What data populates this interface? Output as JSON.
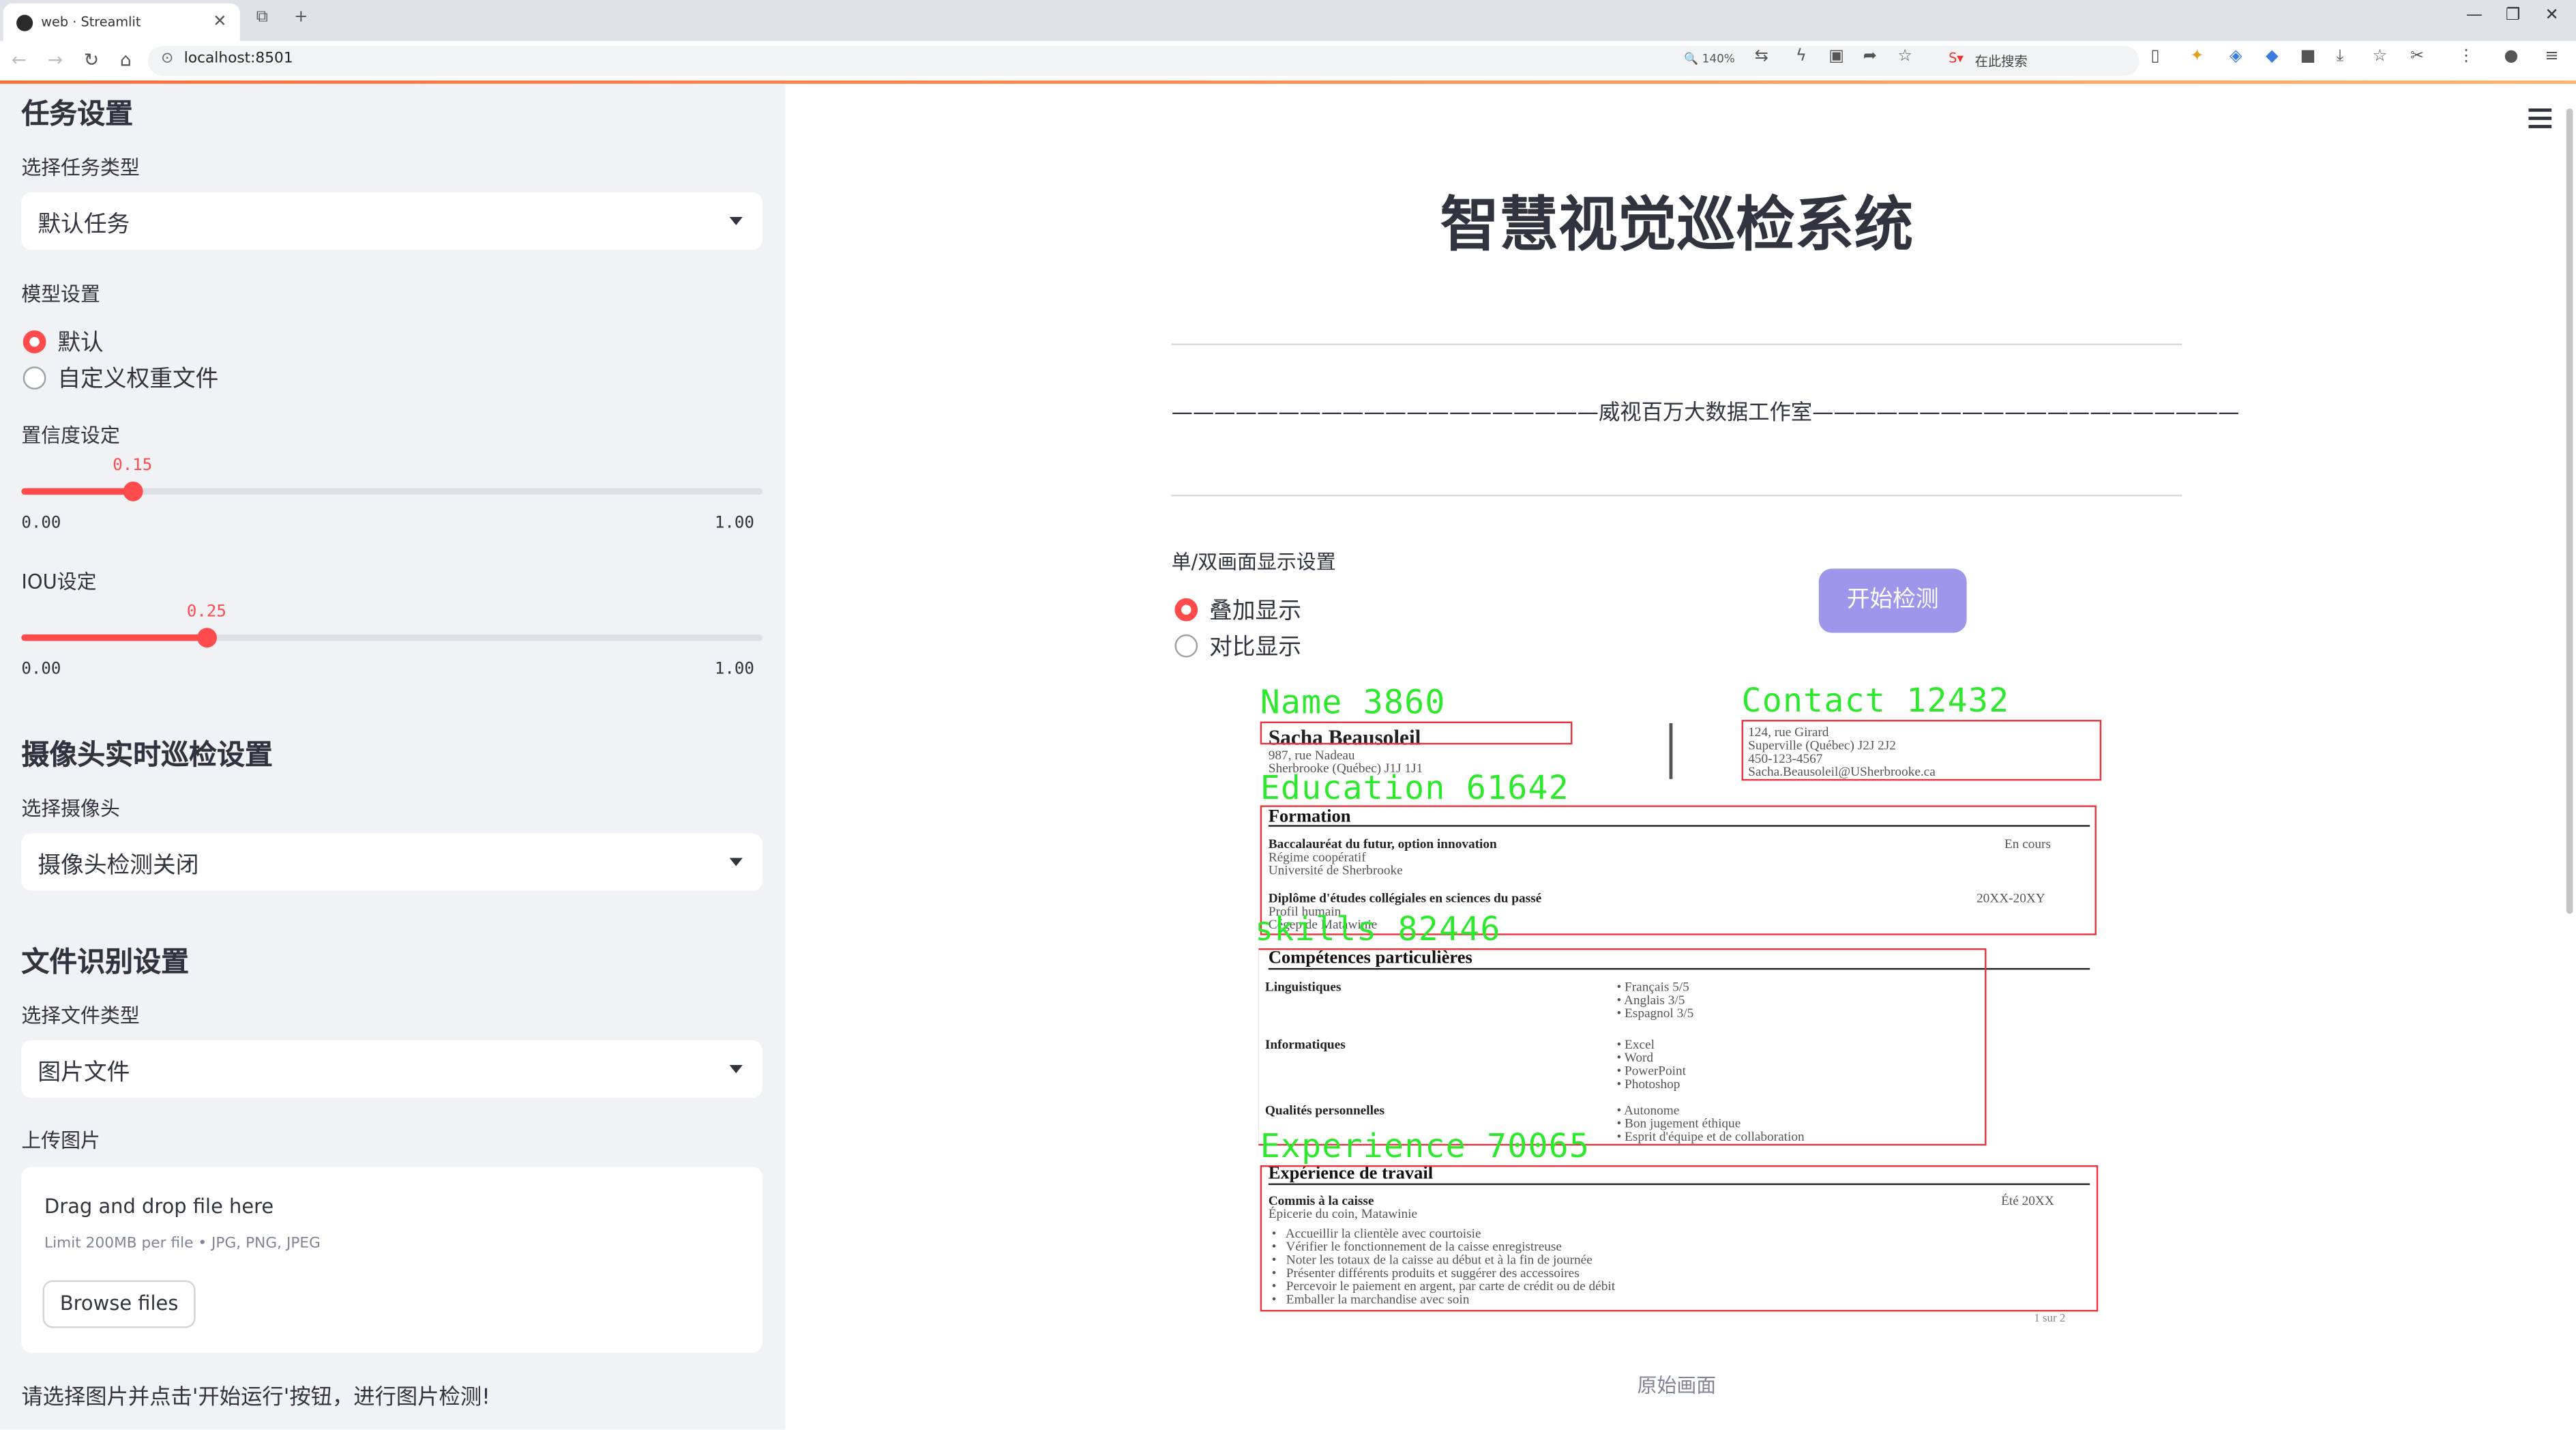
{
  "browser": {
    "tab_title": "web · Streamlit",
    "url": "localhost:8501",
    "zoom": "140%",
    "search_placeholder": "在此搜索"
  },
  "sidebar": {
    "task_section": "任务设置",
    "task_type_label": "选择任务类型",
    "task_type_value": "默认任务",
    "model_label": "模型设置",
    "model_options": [
      "默认",
      "自定义权重文件"
    ],
    "model_selected": 0,
    "conf_label": "置信度设定",
    "conf": {
      "value": 0.15,
      "value_text": "0.15",
      "min_text": "0.00",
      "max_text": "1.00"
    },
    "iou_label": "IOU设定",
    "iou": {
      "value": 0.25,
      "value_text": "0.25",
      "min_text": "0.00",
      "max_text": "1.00"
    },
    "camera_section": "摄像头实时巡检设置",
    "camera_label": "选择摄像头",
    "camera_value": "摄像头检测关闭",
    "file_section": "文件识别设置",
    "file_type_label": "选择文件类型",
    "file_type_value": "图片文件",
    "upload_label": "上传图片",
    "upload": {
      "drag_text": "Drag and drop file here",
      "limit_text": "Limit 200MB per file • JPG, PNG, JPEG",
      "browse_label": "Browse files"
    },
    "hint": "请选择图片并点击'开始运行'按钮，进行图片检测!"
  },
  "main": {
    "title": "智慧视觉巡检系统",
    "studio_line": "————————————————————威视百万大数据工作室————————————————————",
    "display_label": "单/双画面显示设置",
    "display_options": [
      "叠加显示",
      "对比显示"
    ],
    "display_selected": 0,
    "start_button": "开始检测",
    "caption": "原始画面"
  },
  "detections": [
    {
      "label": "Name  3860"
    },
    {
      "label": "Contact  12432"
    },
    {
      "label": "Education  61642"
    },
    {
      "label": "skills  82446"
    },
    {
      "label": "Experience  70065"
    }
  ],
  "resume": {
    "name": "Sacha Beausoleil",
    "address": [
      "987, rue Nadeau",
      "Sherbrooke (Québec) J1J 1J1"
    ],
    "contact": [
      "124, rue Girard",
      "Superville (Québec)  J2J 2J2",
      "450-123-4567",
      "Sacha.Beausoleil@USherbrooke.ca"
    ],
    "formation_title": "Formation",
    "formation": {
      "l1": "Baccalauréat du futur, option innovation",
      "l1_right": "En cours",
      "l2": "Régime coopératif",
      "l3": "Université de Sherbrooke",
      "l4": "Diplôme d'études collégiales en sciences du passé",
      "l4_right": "20XX-20XY",
      "l5": "Profil humain",
      "l6": "Cégep de Matawinie"
    },
    "skills_title": "Compétences particulières",
    "skills": {
      "c1": "Linguistiques",
      "c1_items": [
        "Français    5/5",
        "Anglais     3/5",
        "Espagnol   3/5"
      ],
      "c2": "Informatiques",
      "c2_items": [
        "Excel",
        "Word",
        "PowerPoint",
        "Photoshop"
      ],
      "c3": "Qualités personnelles",
      "c3_items": [
        "Autonome",
        "Bon jugement éthique",
        "Esprit d'équipe et de collaboration"
      ]
    },
    "exp_title": "Expérience de travail",
    "exp": {
      "job": "Commis à la caisse",
      "job_right": "Été 20XX",
      "place": "Épicerie du coin, Matawinie",
      "items": [
        "Accueillir la clientèle avec courtoisie",
        "Vérifier le fonctionnement de la caisse enregistreuse",
        "Noter les totaux de la caisse au début et à la fin de journée",
        "Présenter différents produits et suggérer des accessoires",
        "Percevoir le paiement en argent, par carte de crédit ou de débit",
        "Emballer la marchandise avec soin"
      ],
      "page": "1 sur 2"
    }
  }
}
